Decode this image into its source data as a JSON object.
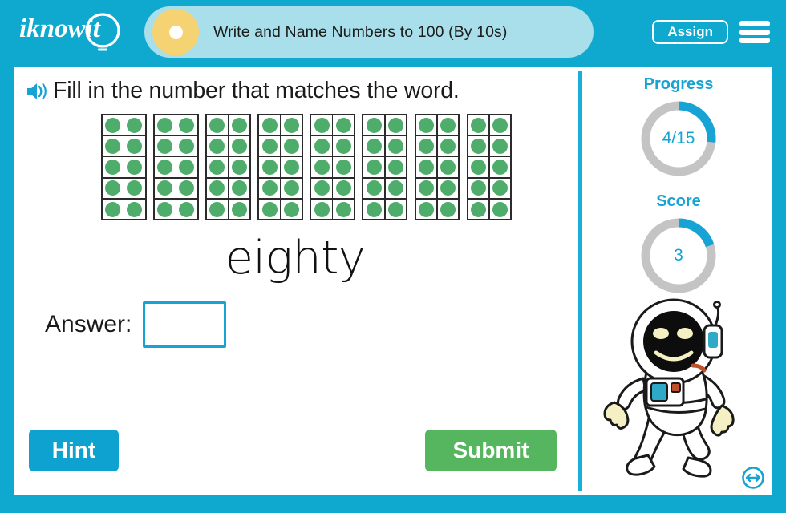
{
  "header": {
    "logo_text": "iknowit",
    "logo_icon": "lightbulb-icon",
    "title": "Write and Name Numbers to 100 (By 10s)",
    "assign_label": "Assign",
    "menu_icon": "hamburger-menu-icon",
    "bar_color": "#0fa8ce",
    "pill_color": "#a9dfea",
    "dot_color": "#f5d372"
  },
  "question": {
    "speaker_icon": "speaker-audio-icon",
    "prompt": "Fill in the number that matches the word.",
    "word": "eighty",
    "answer_label": "Answer:",
    "answer_value": "",
    "answer_placeholder": ""
  },
  "tenframes": {
    "frame_count": 8,
    "rows_per_frame": 5,
    "cols_per_frame": 2,
    "dots_per_frame": 10,
    "total_dots": 80,
    "dot_color": "#4fad6b",
    "border_color": "#2b2b2b"
  },
  "buttons": {
    "hint_label": "Hint",
    "hint_color": "#0ea2d0",
    "submit_label": "Submit",
    "submit_color": "#56b55f"
  },
  "panel": {
    "progress": {
      "title": "Progress",
      "value_text": "4/15",
      "current": 4,
      "total": 15,
      "arc_color": "#17a3d4",
      "track_color": "#c4c4c4"
    },
    "score": {
      "title": "Score",
      "value_text": "3",
      "current": 3,
      "total": 15,
      "arc_color": "#17a3d4",
      "track_color": "#c4c4c4"
    },
    "mascot": "astronaut-mascot",
    "resize_icon": "resize-horizontal-icon"
  }
}
